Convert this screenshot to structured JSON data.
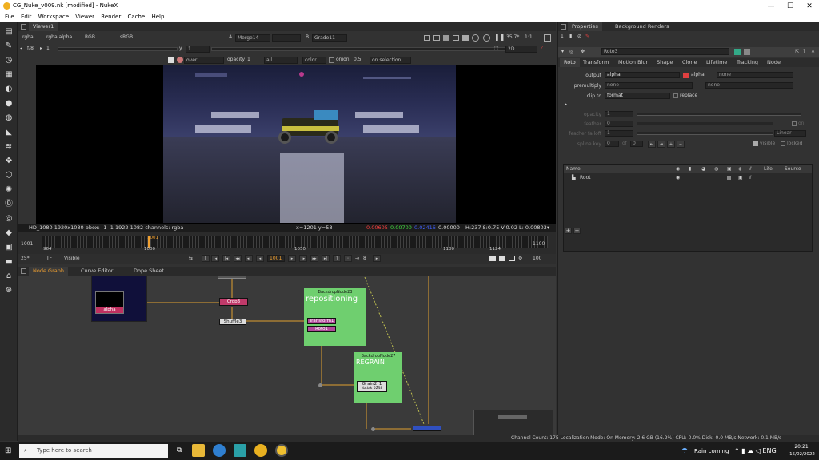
{
  "window": {
    "title": "CG_Nuke_v009.nk [modified] - NukeX"
  },
  "menu": [
    "File",
    "Edit",
    "Workspace",
    "Viewer",
    "Render",
    "Cache",
    "Help"
  ],
  "viewer": {
    "tab": "Viewer1",
    "channels": "rgba",
    "channel2": "rgba.alpha",
    "display": "RGB",
    "colorspace": "sRGB",
    "input_a_label": "A",
    "input_a": "Merge14",
    "input_a_op": "-",
    "input_b_label": "B",
    "input_b": "Grade11",
    "zoom": "35.7*",
    "ratio": "1:1",
    "mode2d": "2D",
    "fstop": "f/8",
    "frame_step": "1",
    "y_label": "y",
    "y_value": "1",
    "gain_value": "0",
    "gamma_value": "1",
    "composite": "over",
    "opacity_label": "opacity",
    "opacity_value": "1",
    "sel1": "all",
    "sel2": "color",
    "onion_label": "onion",
    "onion_value": "0.5",
    "onsel": "on selection",
    "info_format": "HD_1080 1920x1080  bbox: -1 -1 1922 1082 channels: rgba",
    "info_xy": "x=1201 y=58",
    "info_r": "0.00605",
    "info_g": "0.00700",
    "info_b": "0.02416",
    "info_a": "0.00000",
    "info_hsv": "H:237 S:0.75 V:0.02  L: 0.00803"
  },
  "timeline": {
    "start": "1001",
    "end": "1100",
    "ticks": [
      "964",
      "1000",
      "1050",
      "1100",
      "1124"
    ],
    "current": "1001",
    "fps": "25*",
    "tf": "TF",
    "visible": "Visible",
    "frame_field": "1001",
    "increment": "8",
    "end_field": "100"
  },
  "nodegraph": {
    "tabs": [
      "Node Graph",
      "Curve Editor",
      "Dope Sheet"
    ],
    "read_node_label": "alpha",
    "crop": "Crop3",
    "shuffle": "Shuffle3",
    "backdrop1_name": "BackdropNode23",
    "backdrop1_title": "repositioning",
    "transform": "Transform1",
    "roto_node": "Roto1",
    "backdrop2_name": "BackdropNode27",
    "backdrop2_title": "REGRAIN",
    "grain": "Grain2_1",
    "grain_sub": "Kodak 5248"
  },
  "properties": {
    "tabs": [
      "Properties",
      "Background Renders"
    ],
    "count": "1",
    "node_name": "Roto3",
    "subtabs": [
      "Roto",
      "Transform",
      "Motion Blur",
      "Shape",
      "Clone",
      "Lifetime",
      "Tracking",
      "Node"
    ],
    "output_label": "output",
    "output_value": "alpha",
    "alpha_label": "alpha",
    "alpha_none": "none",
    "premultiply_label": "premultiply",
    "premultiply_value": "none",
    "premultiply_none": "none",
    "clip_label": "clip to",
    "clip_value": "format",
    "replace_label": "replace",
    "opacity_label": "opacity",
    "opacity_value": "1",
    "feather_label": "feather",
    "feather_value": "0",
    "feather_falloff_label": "feather falloff",
    "feather_falloff_value": "1",
    "falloff_type": "Linear",
    "on_label": "on",
    "spline_label": "spline key",
    "spline_value": "0",
    "of_label": "of",
    "of_value": "0",
    "visible_label": "visible",
    "locked_label": "locked",
    "scale_ticks": [
      "0",
      "0.1",
      "0.2",
      "0.3",
      "0.4",
      "0.5",
      "0.6",
      "0.7",
      "0.8",
      "0.9",
      "1"
    ],
    "table_headers": [
      "Name",
      "Life",
      "Source"
    ],
    "root_label": "Root"
  },
  "status": {
    "text": "Channel Count: 175  Localization Mode: On  Memory: 2.6 GB (16.2%)  CPU: 0.0%  Disk: 0.0 MB/s  Network: 0.1 MB/s"
  },
  "taskbar": {
    "search_placeholder": "Type here to search",
    "weather": "Rain coming",
    "time": "20:21",
    "date": "15/02/2022"
  }
}
